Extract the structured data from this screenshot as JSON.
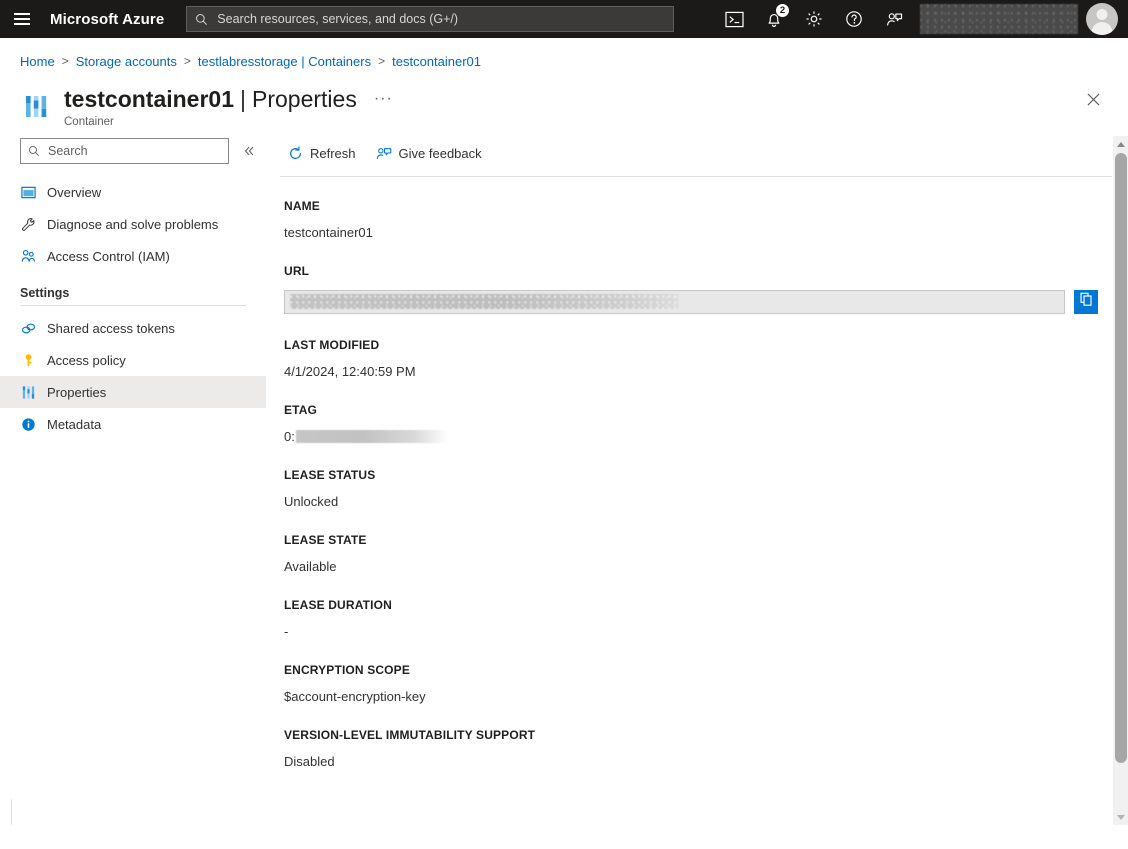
{
  "topbar": {
    "menu_icon": "hamburger-icon",
    "brand": "Microsoft Azure",
    "search": {
      "placeholder": "Search resources, services, and docs (G+/)",
      "value": "",
      "icon": "search-icon"
    },
    "icons": [
      {
        "name": "cloud-shell-icon",
        "label": "Cloud Shell"
      },
      {
        "name": "notifications-icon",
        "label": "Notifications",
        "badge": "2"
      },
      {
        "name": "gear-icon",
        "label": "Settings"
      },
      {
        "name": "help-icon",
        "label": "Help"
      },
      {
        "name": "feedback-icon",
        "label": "Feedback"
      }
    ],
    "account_redacted": true,
    "avatar": "user-avatar"
  },
  "breadcrumb": {
    "items": [
      {
        "label": "Home",
        "link": true
      },
      {
        "label": "Storage accounts",
        "link": true
      },
      {
        "label": "testlabresstorage | Containers",
        "link": true
      },
      {
        "label": "testcontainer01",
        "link": true
      }
    ],
    "separator": ">"
  },
  "header": {
    "icon": "properties-icon",
    "title": "testcontainer01",
    "separator": "|",
    "section": "Properties",
    "subtitle": "Container",
    "more_label": "···",
    "close_label": "✕"
  },
  "sidebar": {
    "search": {
      "placeholder": "Search",
      "value": "",
      "icon": "search-icon"
    },
    "collapse_label": "«",
    "items": [
      {
        "label": "Overview",
        "icon": "overview-icon",
        "selected": false
      },
      {
        "label": "Diagnose and solve problems",
        "icon": "wrench-icon",
        "selected": false
      },
      {
        "label": "Access Control (IAM)",
        "icon": "people-icon",
        "selected": false
      }
    ],
    "group_title": "Settings",
    "settings_items": [
      {
        "label": "Shared access tokens",
        "icon": "link-icon",
        "selected": false
      },
      {
        "label": "Access policy",
        "icon": "key-icon",
        "selected": false
      },
      {
        "label": "Properties",
        "icon": "properties-icon",
        "selected": true
      },
      {
        "label": "Metadata",
        "icon": "info-icon",
        "selected": false
      }
    ]
  },
  "toolbar": {
    "refresh_label": "Refresh",
    "refresh_icon": "refresh-icon",
    "feedback_label": "Give feedback",
    "feedback_icon": "feedback-icon"
  },
  "properties": [
    {
      "label": "NAME",
      "value": "testcontainer01",
      "type": "text"
    },
    {
      "label": "URL",
      "value": "",
      "type": "url-input",
      "redacted": true,
      "copy_icon": "copy-icon"
    },
    {
      "label": "LAST MODIFIED",
      "value": "4/1/2024, 12:40:59 PM",
      "type": "text"
    },
    {
      "label": "ETAG",
      "value": "0:",
      "type": "redacted-text",
      "redacted": true
    },
    {
      "label": "LEASE STATUS",
      "value": "Unlocked",
      "type": "text"
    },
    {
      "label": "LEASE STATE",
      "value": "Available",
      "type": "text"
    },
    {
      "label": "LEASE DURATION",
      "value": "-",
      "type": "text"
    },
    {
      "label": "ENCRYPTION SCOPE",
      "value": "$account-encryption-key",
      "type": "text"
    },
    {
      "label": "VERSION-LEVEL IMMUTABILITY SUPPORT",
      "value": "Disabled",
      "type": "text"
    }
  ],
  "colors": {
    "topbar_bg": "#1b1a19",
    "link": "#0067b8",
    "accent": "#0078d4",
    "selected_row": "#edebe9",
    "text": "#323130"
  }
}
